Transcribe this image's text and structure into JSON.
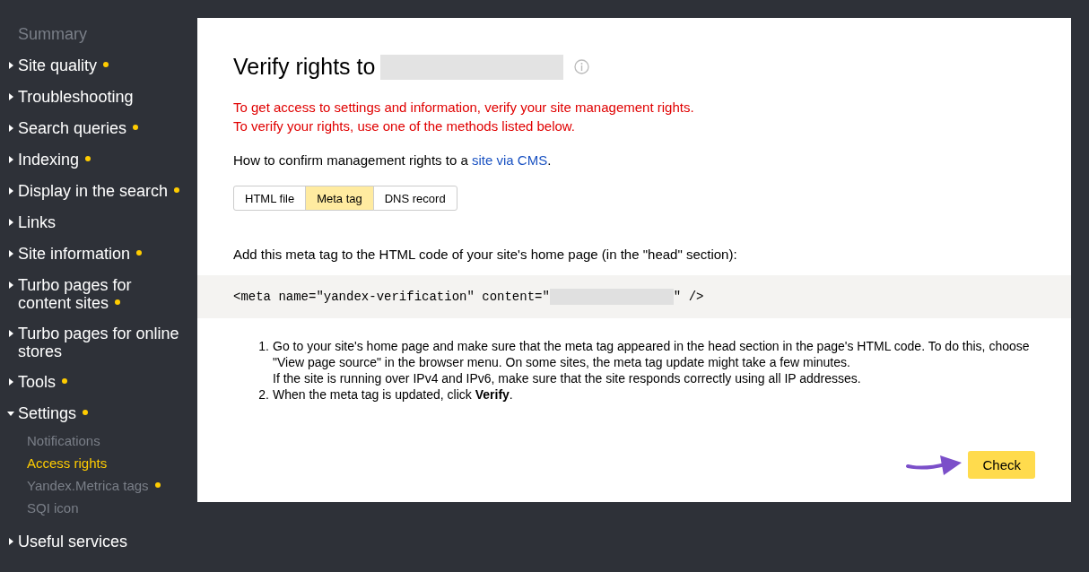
{
  "sidebar": {
    "items": [
      {
        "label": "Summary",
        "kind": "plain",
        "dot": false
      },
      {
        "label": "Site quality",
        "kind": "section",
        "expanded": false,
        "dot": true
      },
      {
        "label": "Troubleshooting",
        "kind": "section",
        "expanded": false,
        "dot": false
      },
      {
        "label": "Search queries",
        "kind": "section",
        "expanded": false,
        "dot": true
      },
      {
        "label": "Indexing",
        "kind": "section",
        "expanded": false,
        "dot": true
      },
      {
        "label": "Display in the search",
        "kind": "section",
        "expanded": false,
        "dot": true
      },
      {
        "label": "Links",
        "kind": "section",
        "expanded": false,
        "dot": false
      },
      {
        "label": "Site information",
        "kind": "section",
        "expanded": false,
        "dot": true
      },
      {
        "label": "Turbo pages for content sites",
        "kind": "section",
        "expanded": false,
        "dot": true
      },
      {
        "label": "Turbo pages for online stores",
        "kind": "section",
        "expanded": false,
        "dot": false
      },
      {
        "label": "Tools",
        "kind": "section",
        "expanded": false,
        "dot": true
      },
      {
        "label": "Settings",
        "kind": "section",
        "expanded": true,
        "dot": true,
        "children": [
          {
            "label": "Notifications",
            "selected": false,
            "dot": false
          },
          {
            "label": "Access rights",
            "selected": true,
            "dot": false
          },
          {
            "label": "Yandex.Metrica tags",
            "selected": false,
            "dot": true
          },
          {
            "label": "SQI icon",
            "selected": false,
            "dot": false
          }
        ]
      },
      {
        "label": "Useful services",
        "kind": "section",
        "expanded": false,
        "dot": false
      }
    ]
  },
  "main": {
    "title": "Verify rights to",
    "warning": [
      "To get access to settings and information, verify your site management rights.",
      "To verify your rights, use one of the methods listed below."
    ],
    "cms_text": "How to confirm management rights to a",
    "cms_link": "site via CMS",
    "cms_end": ".",
    "tabs": [
      {
        "label": "HTML file",
        "selected": false
      },
      {
        "label": "Meta tag",
        "selected": true
      },
      {
        "label": "DNS record",
        "selected": false
      }
    ],
    "instruction": "Add this meta tag to the HTML code of your site's home page (in the \"head\" section):",
    "code_start": "<meta name=\"yandex-verification\" content=\"",
    "code_end": "\" />",
    "steps": [
      {
        "number": "1.",
        "lines": [
          "Go to your site's home page and make sure that the meta tag appeared in the head section in the page's HTML code. To do this, choose \"View page source\" in the browser menu. On some sites, the meta tag update might take a few minutes.",
          "If the site is running over IPv4 and IPv6, make sure that the site responds correctly using all IP addresses."
        ]
      },
      {
        "number": "2.",
        "lines": [
          "When the meta tag is updated, click **Verify**."
        ]
      }
    ],
    "check_button": "Check"
  }
}
